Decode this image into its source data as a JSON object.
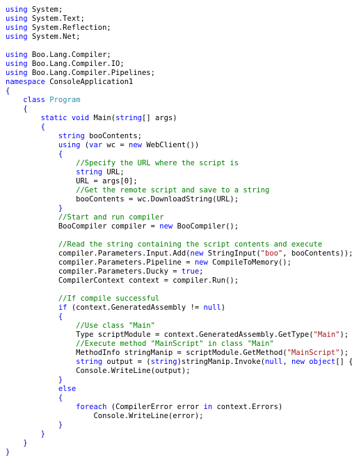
{
  "document": {
    "kind": "source-code-listing",
    "language": "C#",
    "background_color": "#FFFFFF",
    "theme": {
      "plain": "#000000",
      "keyword": "#0000FF",
      "type": "#2B91AF",
      "comment": "#008000",
      "string": "#A31515",
      "brace": "#0000C0"
    }
  },
  "code": {
    "lines": [
      [
        {
          "t": "keyword",
          "s": "using"
        },
        {
          "t": "plain",
          "s": " System;"
        }
      ],
      [
        {
          "t": "keyword",
          "s": "using"
        },
        {
          "t": "plain",
          "s": " System.Text;"
        }
      ],
      [
        {
          "t": "keyword",
          "s": "using"
        },
        {
          "t": "plain",
          "s": " System.Reflection;"
        }
      ],
      [
        {
          "t": "keyword",
          "s": "using"
        },
        {
          "t": "plain",
          "s": " System.Net;"
        }
      ],
      [],
      [
        {
          "t": "keyword",
          "s": "using"
        },
        {
          "t": "plain",
          "s": " Boo.Lang.Compiler;"
        }
      ],
      [
        {
          "t": "keyword",
          "s": "using"
        },
        {
          "t": "plain",
          "s": " Boo.Lang.Compiler.IO;"
        }
      ],
      [
        {
          "t": "keyword",
          "s": "using"
        },
        {
          "t": "plain",
          "s": " Boo.Lang.Compiler.Pipelines;"
        }
      ],
      [
        {
          "t": "keyword",
          "s": "namespace"
        },
        {
          "t": "plain",
          "s": " ConsoleApplication1"
        }
      ],
      [
        {
          "t": "brace",
          "s": "{"
        }
      ],
      [
        {
          "t": "plain",
          "s": "    "
        },
        {
          "t": "keyword",
          "s": "class"
        },
        {
          "t": "plain",
          "s": " "
        },
        {
          "t": "type",
          "s": "Program"
        }
      ],
      [
        {
          "t": "plain",
          "s": "    "
        },
        {
          "t": "brace",
          "s": "{"
        }
      ],
      [
        {
          "t": "plain",
          "s": "        "
        },
        {
          "t": "keyword",
          "s": "static"
        },
        {
          "t": "plain",
          "s": " "
        },
        {
          "t": "keyword",
          "s": "void"
        },
        {
          "t": "plain",
          "s": " Main("
        },
        {
          "t": "keyword",
          "s": "string"
        },
        {
          "t": "plain",
          "s": "[] args)"
        }
      ],
      [
        {
          "t": "plain",
          "s": "        "
        },
        {
          "t": "brace",
          "s": "{"
        }
      ],
      [
        {
          "t": "plain",
          "s": "            "
        },
        {
          "t": "keyword",
          "s": "string"
        },
        {
          "t": "plain",
          "s": " booContents;"
        }
      ],
      [
        {
          "t": "plain",
          "s": "            "
        },
        {
          "t": "keyword",
          "s": "using"
        },
        {
          "t": "plain",
          "s": " ("
        },
        {
          "t": "keyword",
          "s": "var"
        },
        {
          "t": "plain",
          "s": " wc = "
        },
        {
          "t": "keyword",
          "s": "new"
        },
        {
          "t": "plain",
          "s": " WebClient())"
        }
      ],
      [
        {
          "t": "plain",
          "s": "            "
        },
        {
          "t": "brace",
          "s": "{"
        }
      ],
      [
        {
          "t": "plain",
          "s": "                "
        },
        {
          "t": "comment",
          "s": "//Specify the URL where the script is"
        }
      ],
      [
        {
          "t": "plain",
          "s": "                "
        },
        {
          "t": "keyword",
          "s": "string"
        },
        {
          "t": "plain",
          "s": " URL;"
        }
      ],
      [
        {
          "t": "plain",
          "s": "                "
        },
        {
          "t": "plain",
          "s": "URL = args[0];"
        }
      ],
      [
        {
          "t": "plain",
          "s": "                "
        },
        {
          "t": "comment",
          "s": "//Get the remote script and save to a string"
        }
      ],
      [
        {
          "t": "plain",
          "s": "                "
        },
        {
          "t": "plain",
          "s": "booContents = wc.DownloadString(URL);"
        }
      ],
      [
        {
          "t": "plain",
          "s": "            "
        },
        {
          "t": "brace",
          "s": "}"
        }
      ],
      [
        {
          "t": "plain",
          "s": "            "
        },
        {
          "t": "comment",
          "s": "//Start and run compiler"
        }
      ],
      [
        {
          "t": "plain",
          "s": "            "
        },
        {
          "t": "plain",
          "s": "BooCompiler compiler = "
        },
        {
          "t": "keyword",
          "s": "new"
        },
        {
          "t": "plain",
          "s": " BooCompiler();"
        }
      ],
      [],
      [
        {
          "t": "plain",
          "s": "            "
        },
        {
          "t": "comment",
          "s": "//Read the string containing the script contents and execute"
        }
      ],
      [
        {
          "t": "plain",
          "s": "            "
        },
        {
          "t": "plain",
          "s": "compiler.Parameters.Input.Add("
        },
        {
          "t": "keyword",
          "s": "new"
        },
        {
          "t": "plain",
          "s": " StringInput("
        },
        {
          "t": "string",
          "s": "\"boo\""
        },
        {
          "t": "plain",
          "s": ", booContents));"
        }
      ],
      [
        {
          "t": "plain",
          "s": "            "
        },
        {
          "t": "plain",
          "s": "compiler.Parameters.Pipeline = "
        },
        {
          "t": "keyword",
          "s": "new"
        },
        {
          "t": "plain",
          "s": " CompileToMemory();"
        }
      ],
      [
        {
          "t": "plain",
          "s": "            "
        },
        {
          "t": "plain",
          "s": "compiler.Parameters.Ducky = "
        },
        {
          "t": "keyword",
          "s": "true"
        },
        {
          "t": "plain",
          "s": ";"
        }
      ],
      [
        {
          "t": "plain",
          "s": "            "
        },
        {
          "t": "plain",
          "s": "CompilerContext context = compiler.Run();"
        }
      ],
      [],
      [
        {
          "t": "plain",
          "s": "            "
        },
        {
          "t": "comment",
          "s": "//If compile successful"
        }
      ],
      [
        {
          "t": "plain",
          "s": "            "
        },
        {
          "t": "keyword",
          "s": "if"
        },
        {
          "t": "plain",
          "s": " (context.GeneratedAssembly != "
        },
        {
          "t": "keyword",
          "s": "null"
        },
        {
          "t": "plain",
          "s": ")"
        }
      ],
      [
        {
          "t": "plain",
          "s": "            "
        },
        {
          "t": "brace",
          "s": "{"
        }
      ],
      [
        {
          "t": "plain",
          "s": "                "
        },
        {
          "t": "comment",
          "s": "//Use class \"Main\""
        }
      ],
      [
        {
          "t": "plain",
          "s": "                "
        },
        {
          "t": "plain",
          "s": "Type scriptModule = context.GeneratedAssembly.GetType("
        },
        {
          "t": "string",
          "s": "\"Main\""
        },
        {
          "t": "plain",
          "s": ");"
        }
      ],
      [
        {
          "t": "plain",
          "s": "                "
        },
        {
          "t": "comment",
          "s": "//Execute method \"MainScript\" in class \"Main\""
        }
      ],
      [
        {
          "t": "plain",
          "s": "                "
        },
        {
          "t": "plain",
          "s": "MethodInfo stringManip = scriptModule.GetMethod("
        },
        {
          "t": "string",
          "s": "\"MainScript\""
        },
        {
          "t": "plain",
          "s": ");"
        }
      ],
      [
        {
          "t": "plain",
          "s": "                "
        },
        {
          "t": "keyword",
          "s": "string"
        },
        {
          "t": "plain",
          "s": " output = ("
        },
        {
          "t": "keyword",
          "s": "string"
        },
        {
          "t": "plain",
          "s": ")stringManip.Invoke("
        },
        {
          "t": "keyword",
          "s": "null"
        },
        {
          "t": "plain",
          "s": ", "
        },
        {
          "t": "keyword",
          "s": "new"
        },
        {
          "t": "plain",
          "s": " "
        },
        {
          "t": "keyword",
          "s": "object"
        },
        {
          "t": "plain",
          "s": "[] { });"
        }
      ],
      [
        {
          "t": "plain",
          "s": "                "
        },
        {
          "t": "plain",
          "s": "Console.WriteLine(output);"
        }
      ],
      [
        {
          "t": "plain",
          "s": "            "
        },
        {
          "t": "brace",
          "s": "}"
        }
      ],
      [
        {
          "t": "plain",
          "s": "            "
        },
        {
          "t": "keyword",
          "s": "else"
        }
      ],
      [
        {
          "t": "plain",
          "s": "            "
        },
        {
          "t": "brace",
          "s": "{"
        }
      ],
      [
        {
          "t": "plain",
          "s": "                "
        },
        {
          "t": "keyword",
          "s": "foreach"
        },
        {
          "t": "plain",
          "s": " (CompilerError error "
        },
        {
          "t": "keyword",
          "s": "in"
        },
        {
          "t": "plain",
          "s": " context.Errors)"
        }
      ],
      [
        {
          "t": "plain",
          "s": "                    "
        },
        {
          "t": "plain",
          "s": "Console.WriteLine(error);"
        }
      ],
      [
        {
          "t": "plain",
          "s": "            "
        },
        {
          "t": "brace",
          "s": "}"
        }
      ],
      [
        {
          "t": "plain",
          "s": "        "
        },
        {
          "t": "brace",
          "s": "}"
        }
      ],
      [
        {
          "t": "plain",
          "s": "    "
        },
        {
          "t": "brace",
          "s": "}"
        }
      ],
      [
        {
          "t": "brace",
          "s": "}"
        }
      ]
    ]
  }
}
